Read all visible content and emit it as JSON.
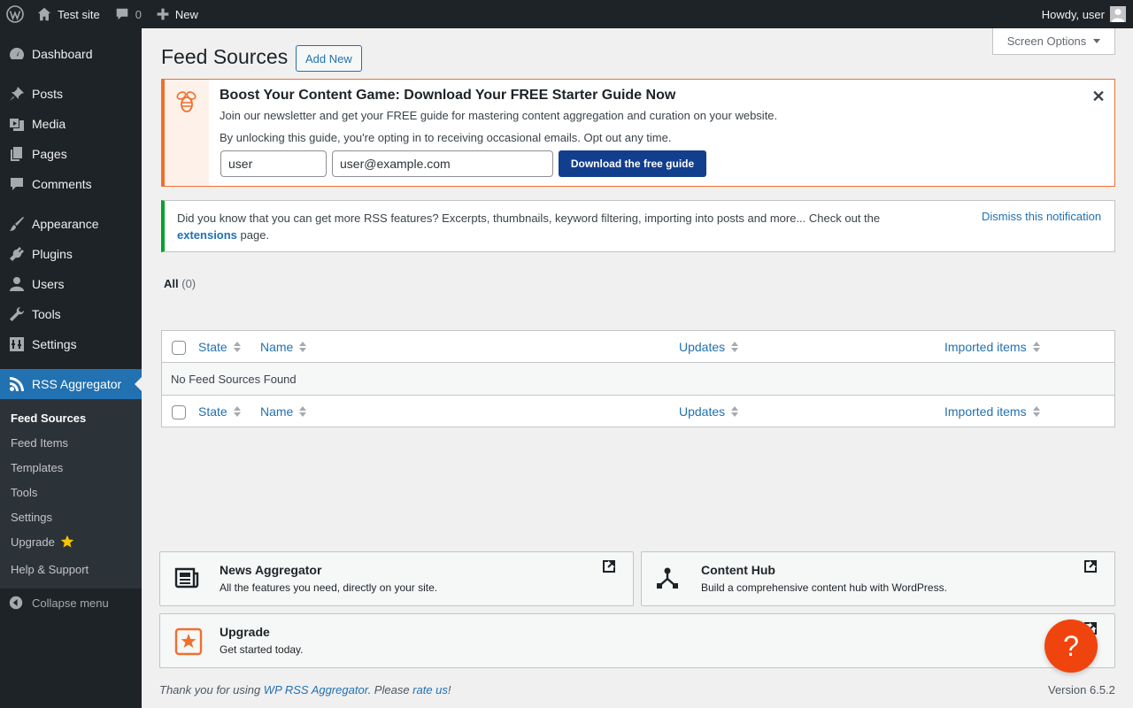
{
  "admin_bar": {
    "site_name": "Test site",
    "comments_count": "0",
    "new_label": "New",
    "greeting": "Howdy, user"
  },
  "sidebar": {
    "items": [
      {
        "label": "Dashboard",
        "icon": "dashboard-icon"
      },
      {
        "label": "Posts",
        "icon": "pin-icon"
      },
      {
        "label": "Media",
        "icon": "media-icon"
      },
      {
        "label": "Pages",
        "icon": "pages-icon"
      },
      {
        "label": "Comments",
        "icon": "comment-icon"
      },
      {
        "label": "Appearance",
        "icon": "brush-icon"
      },
      {
        "label": "Plugins",
        "icon": "plugin-icon"
      },
      {
        "label": "Users",
        "icon": "user-icon"
      },
      {
        "label": "Tools",
        "icon": "wrench-icon"
      },
      {
        "label": "Settings",
        "icon": "settings-icon"
      },
      {
        "label": "RSS Aggregator",
        "icon": "rss-icon"
      }
    ],
    "submenu": [
      "Feed Sources",
      "Feed Items",
      "Templates",
      "Tools",
      "Settings",
      "Upgrade",
      "Help & Support"
    ],
    "collapse_label": "Collapse menu"
  },
  "main": {
    "screen_options": "Screen Options",
    "title": "Feed Sources",
    "add_new": "Add New",
    "promo": {
      "title": "Boost Your Content Game: Download Your FREE Starter Guide Now",
      "description": "Join our newsletter and get your FREE guide for mastering content aggregation and curation on your website.",
      "note": "By unlocking this guide, you're opting in to receiving occasional emails. Opt out any time.",
      "name_value": "user",
      "email_value": "user@example.com",
      "button": "Download the free guide",
      "close": "✕"
    },
    "notice": {
      "text_before": "Did you know that you can get more RSS features? Excerpts, thumbnails, keyword filtering, importing into posts and more... Check out the ",
      "link": "extensions",
      "text_after": " page.",
      "dismiss": "Dismiss this notification"
    },
    "filter": {
      "label": "All",
      "count": "(0)"
    },
    "table": {
      "columns": [
        "State",
        "Name",
        "Updates",
        "Imported items"
      ],
      "empty_message": "No Feed Sources Found"
    },
    "cards": [
      {
        "title": "News Aggregator",
        "desc": "All the features you need, directly on your site."
      },
      {
        "title": "Content Hub",
        "desc": "Build a comprehensive content hub with WordPress."
      },
      {
        "title": "Upgrade",
        "desc": "Get started today."
      }
    ],
    "help_fab": "?"
  },
  "footer": {
    "text_before": "Thank you for using ",
    "link1": "WP RSS Aggregator",
    "text_mid": ". Please ",
    "link2": "rate us",
    "text_after": "!",
    "version": "Version 6.5.2"
  },
  "colors": {
    "accent": "#2271b1",
    "promo_orange": "#f06f2c",
    "notice_green": "#00a32a",
    "download_button": "#113f8d",
    "help_fab": "#f0440e"
  }
}
